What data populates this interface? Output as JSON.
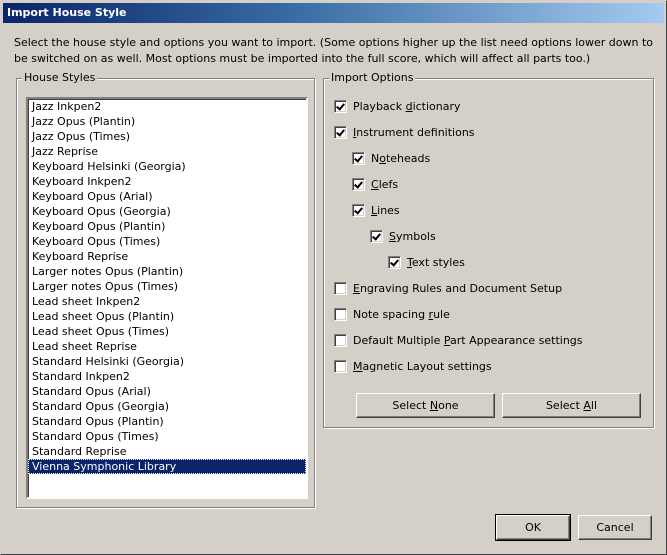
{
  "window": {
    "title": "Import House Style",
    "description": "Select the house style and options you want to import. (Some options higher up the list need options lower down to be switched on as well. Most options must be imported into the full score, which will affect all parts too.)"
  },
  "house_styles": {
    "label": "House Styles",
    "selected": "Vienna Symphonic Library",
    "items": [
      "Jazz Inkpen2",
      "Jazz Opus (Plantin)",
      "Jazz Opus (Times)",
      "Jazz Reprise",
      "Keyboard Helsinki (Georgia)",
      "Keyboard Inkpen2",
      "Keyboard Opus (Arial)",
      "Keyboard Opus (Georgia)",
      "Keyboard Opus (Plantin)",
      "Keyboard Opus (Times)",
      "Keyboard Reprise",
      "Larger notes Opus (Plantin)",
      "Larger notes Opus (Times)",
      "Lead sheet Inkpen2",
      "Lead sheet Opus (Plantin)",
      "Lead sheet Opus (Times)",
      "Lead sheet Reprise",
      "Standard Helsinki (Georgia)",
      "Standard Inkpen2",
      "Standard Opus (Arial)",
      "Standard Opus (Georgia)",
      "Standard Opus (Plantin)",
      "Standard Opus (Times)",
      "Standard Reprise",
      "Vienna Symphonic Library"
    ]
  },
  "import_options": {
    "label": "Import Options",
    "options": [
      {
        "pre": "Playback ",
        "ul": "d",
        "post": "ictionary",
        "checked": true
      },
      {
        "pre": "",
        "ul": "I",
        "post": "nstrument definitions",
        "checked": true
      },
      {
        "pre": "N",
        "ul": "o",
        "post": "teheads",
        "checked": true
      },
      {
        "pre": "",
        "ul": "C",
        "post": "lefs",
        "checked": true
      },
      {
        "pre": "",
        "ul": "L",
        "post": "ines",
        "checked": true
      },
      {
        "pre": "",
        "ul": "S",
        "post": "ymbols",
        "checked": true
      },
      {
        "pre": "",
        "ul": "T",
        "post": "ext styles",
        "checked": true
      },
      {
        "pre": "",
        "ul": "E",
        "post": "ngraving Rules and Document Setup",
        "checked": false
      },
      {
        "pre": "Note spacing ",
        "ul": "r",
        "post": "ule",
        "checked": false
      },
      {
        "pre": "Default Multiple ",
        "ul": "P",
        "post": "art Appearance settings",
        "checked": false
      },
      {
        "pre": "",
        "ul": "M",
        "post": "agnetic Layout settings",
        "checked": false
      }
    ],
    "select_none": {
      "pre": "Select ",
      "ul": "N",
      "post": "one"
    },
    "select_all": {
      "pre": "Select ",
      "ul": "A",
      "post": "ll"
    }
  },
  "footer": {
    "ok_label": "OK",
    "cancel_label": "Cancel"
  }
}
